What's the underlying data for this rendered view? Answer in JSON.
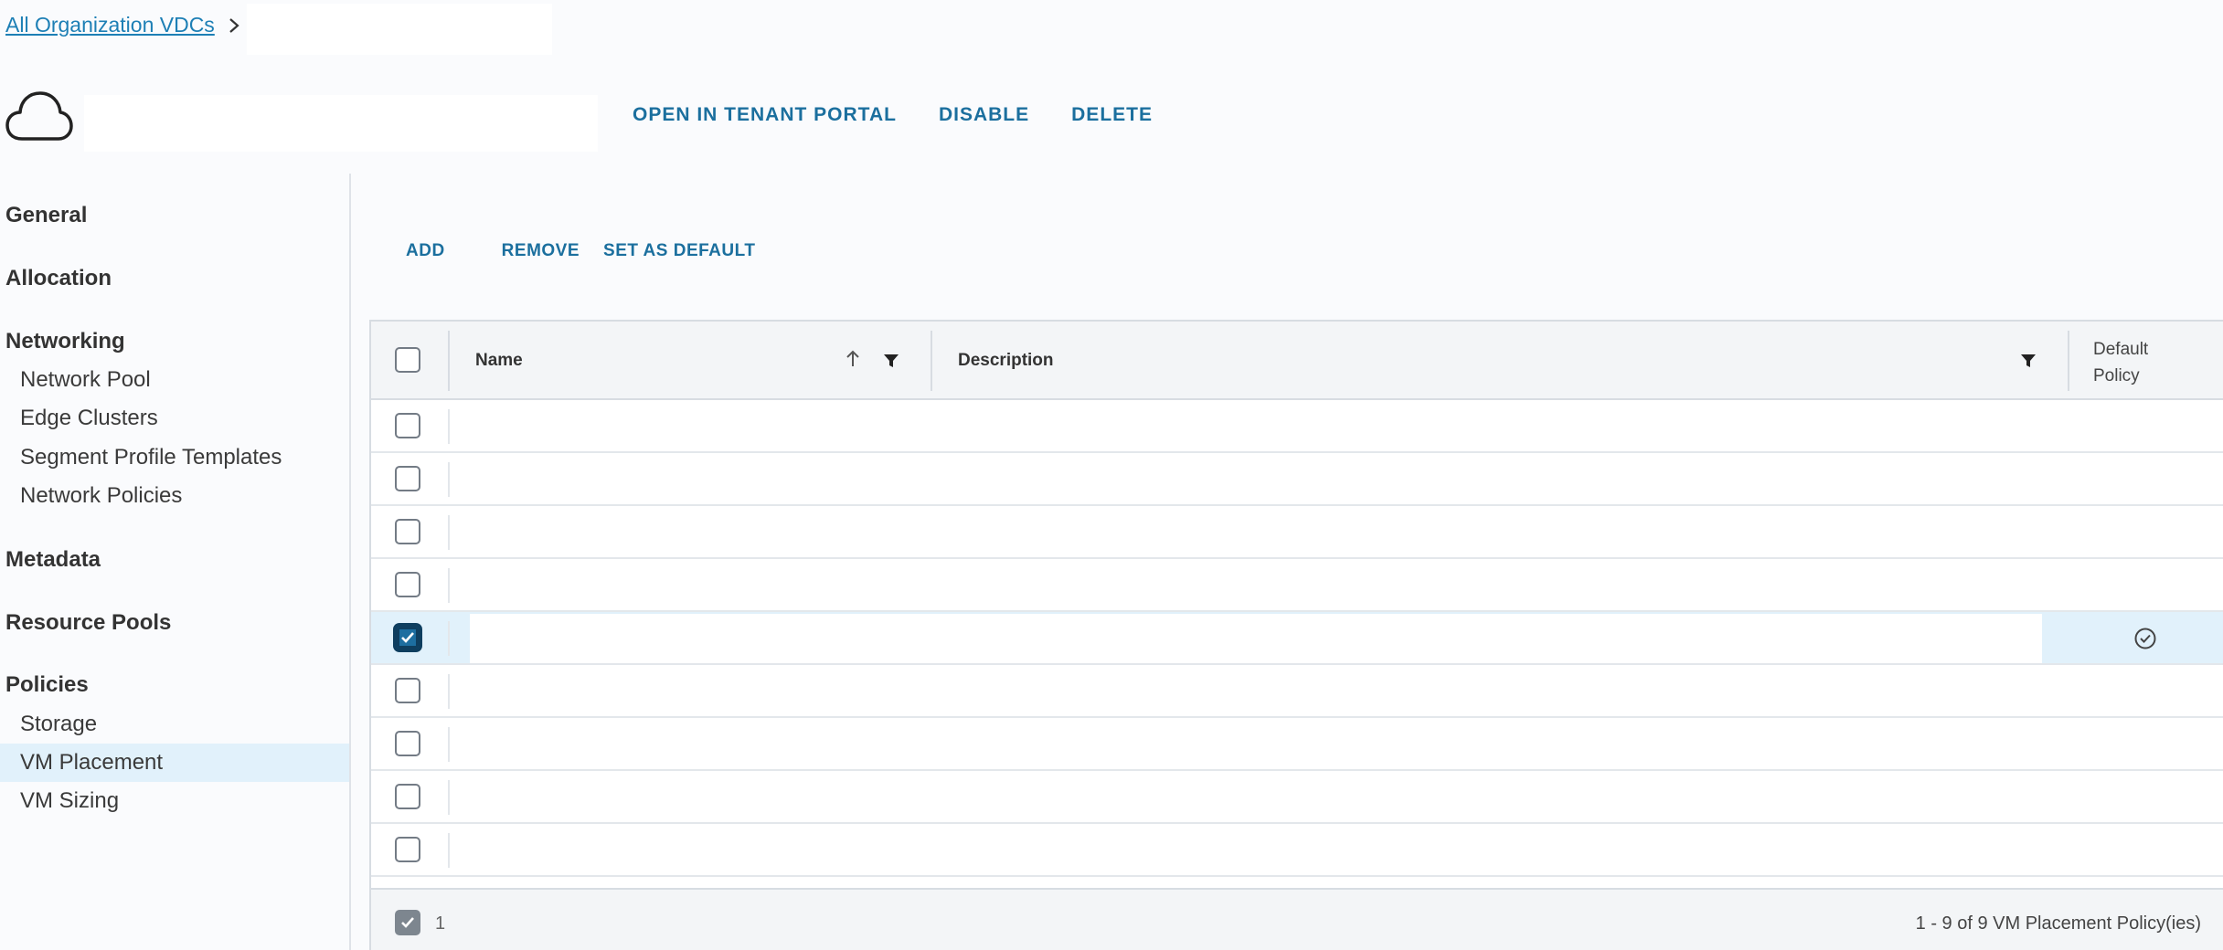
{
  "breadcrumb": {
    "link": "All Organization VDCs"
  },
  "header": {
    "actions": {
      "open_tenant_portal": "OPEN IN TENANT PORTAL",
      "disable": "DISABLE",
      "delete": "DELETE"
    }
  },
  "sidebar": {
    "general": "General",
    "allocation": "Allocation",
    "networking": {
      "label": "Networking",
      "items": [
        "Network Pool",
        "Edge Clusters",
        "Segment Profile Templates",
        "Network Policies"
      ]
    },
    "metadata": "Metadata",
    "resource_pools": "Resource Pools",
    "policies": {
      "label": "Policies",
      "items": [
        "Storage",
        "VM Placement",
        "VM Sizing"
      ],
      "active": "VM Placement"
    }
  },
  "toolbar": {
    "add": "ADD",
    "remove": "REMOVE",
    "set_default": "SET AS DEFAULT"
  },
  "grid": {
    "columns": {
      "name": "Name",
      "description": "Description",
      "default_policy_line1": "Default",
      "default_policy_line2": "Policy"
    },
    "row_count": 9,
    "selected_row_index": 4,
    "default_row_index": 4,
    "footer": {
      "selected_count": "1",
      "pagination": "1 - 9 of 9 VM Placement Policy(ies)"
    }
  },
  "colors": {
    "link": "#1d7fb5",
    "action": "#1b6f9e",
    "selection": "#e1f1fb"
  }
}
